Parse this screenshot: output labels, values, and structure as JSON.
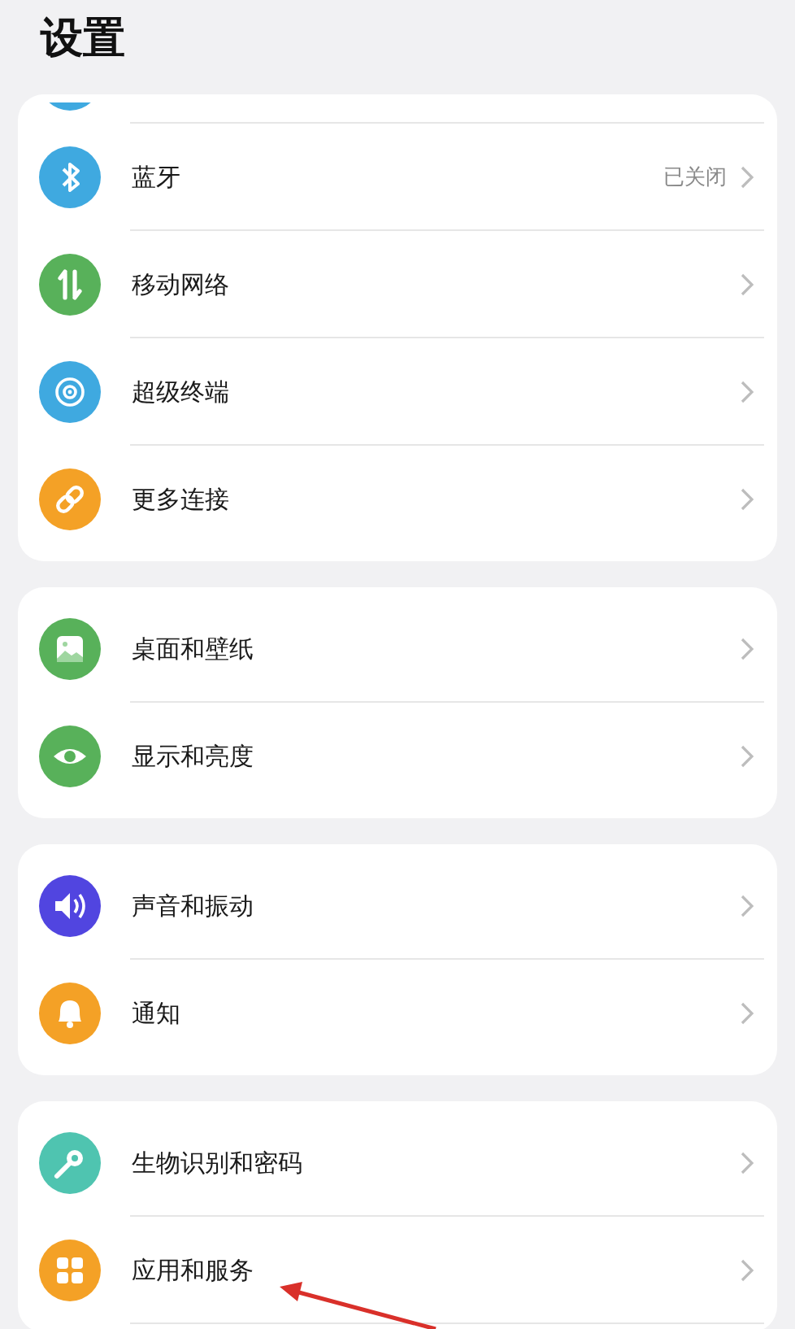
{
  "title": "设置",
  "groups": [
    {
      "items": [
        {
          "kind": "clipped",
          "color": "#3fa9e0"
        },
        {
          "kind": "row",
          "label": "蓝牙",
          "status": "已关闭",
          "color": "#3fa9e0"
        },
        {
          "kind": "row",
          "label": "移动网络",
          "color": "#58b15a"
        },
        {
          "kind": "row",
          "label": "超级终端",
          "color": "#3fa9e0"
        },
        {
          "kind": "row",
          "label": "更多连接",
          "color": "#f4a126"
        }
      ]
    },
    {
      "items": [
        {
          "kind": "row",
          "label": "桌面和壁纸",
          "color": "#58b15a"
        },
        {
          "kind": "row",
          "label": "显示和亮度",
          "color": "#58b15a"
        }
      ]
    },
    {
      "items": [
        {
          "kind": "row",
          "label": "声音和振动",
          "color": "#5145e0"
        },
        {
          "kind": "row",
          "label": "通知",
          "color": "#f4a126"
        }
      ]
    },
    {
      "items": [
        {
          "kind": "row",
          "label": "生物识别和密码",
          "color": "#4fc4b0"
        },
        {
          "kind": "row",
          "label": "应用和服务",
          "color": "#f4a126"
        }
      ]
    }
  ]
}
